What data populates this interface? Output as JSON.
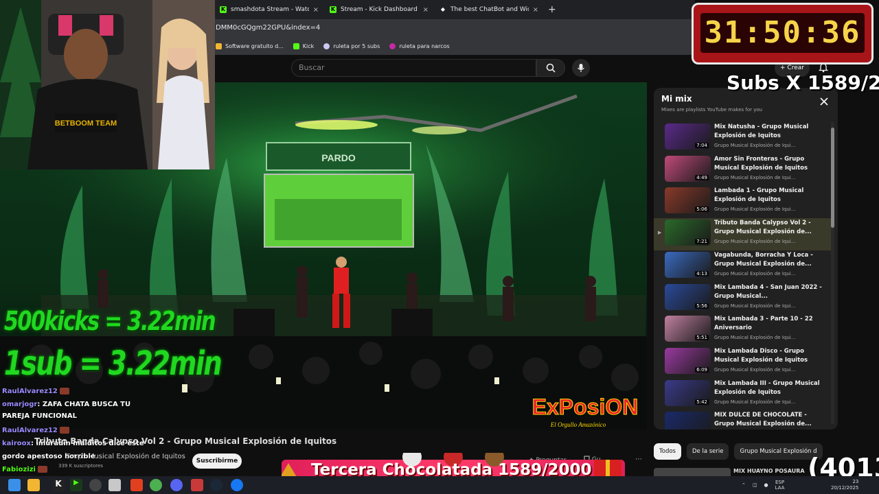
{
  "browser": {
    "tabs": [
      {
        "label": "smashdota Stream - Watch Live",
        "icon": "kick-icon"
      },
      {
        "label": "Stream - Kick Dashboard",
        "icon": "kick-icon"
      },
      {
        "label": "The best ChatBot and Widgets",
        "icon": "botrix-icon"
      }
    ],
    "address": "DMM0cGQgm22GPU&index=4",
    "bookmarks": [
      {
        "label": "Software gratuito d...",
        "icon": "folder-icon"
      },
      {
        "label": "Kick",
        "icon": "kick-icon"
      },
      {
        "label": "ruleta por 5 subs",
        "icon": "wheel-icon"
      },
      {
        "label": "ruleta para narcos",
        "icon": "wheel-icon"
      }
    ]
  },
  "youtube": {
    "search_placeholder": "Buscar",
    "create_label": "Crear",
    "video_title": "Tributo Banda Calypso Vol 2 - Grupo Musical Explosión de Iquitos",
    "channel": "Grupo Musical Explosión de Iquitos",
    "subscribers": "339 K suscriptores",
    "subscribe_label": "Suscribirme",
    "ask_label": "Preguntar",
    "save_label": "Gu",
    "video_logo": "ExPosiON",
    "video_logo_sub": "El Orgullo Amazónico",
    "stage_sign": "PARDO"
  },
  "mix": {
    "title": "Mi mix",
    "subtitle": "Mixes are playlists YouTube makes for you",
    "items": [
      {
        "title": "Mix Natusha - Grupo Musical Explosión de Iquitos",
        "channel": "Grupo Musical Explosión de Iqui...",
        "duration": "7:04"
      },
      {
        "title": "Amor Sin Fronteras - Grupo Musical Explosión de Iquitos",
        "channel": "Grupo Musical Explosión de Iqui...",
        "duration": "4:49"
      },
      {
        "title": "Lambada 1 - Grupo Musical Explosión de Iquitos",
        "channel": "Grupo Musical Explosión de Iqui...",
        "duration": "5:06"
      },
      {
        "title": "Tributo Banda Calypso Vol 2 - Grupo Musical Explosión de...",
        "channel": "Grupo Musical Explosión de Iqui...",
        "duration": "7:21"
      },
      {
        "title": "Vagabunda, Borracha Y Loca - Grupo Musical Explosión de...",
        "channel": "Grupo Musical Explosión de Iqui...",
        "duration": "4:13"
      },
      {
        "title": "Mix Lambada 4 - San Juan 2022 - Grupo Musical...",
        "channel": "Grupo Musical Explosión de Iqui...",
        "duration": "5:56"
      },
      {
        "title": "Mix Lambada 3 - Parte 10 - 22 Aniversario",
        "channel": "Grupo Musical Explosión de Iqui...",
        "duration": "5:51"
      },
      {
        "title": "Mix Lambada Disco - Grupo Musical Explosión de Iquitos",
        "channel": "Grupo Musical Explosión de Iqui...",
        "duration": "6:09"
      },
      {
        "title": "Mix Lambada III - Grupo Musical Explosión de Iquitos",
        "channel": "Grupo Musical Explosión de Iqui...",
        "duration": "5:42"
      },
      {
        "title": "MIX DULCE DE CHOCOLATE - Grupo Musical Explosión de...",
        "channel": "",
        "duration": ""
      }
    ],
    "active_index": 3
  },
  "chips": [
    "Todos",
    "De la serie",
    "Grupo Musical Explosión d"
  ],
  "next_video_title": "MIX HUAYNO POSAURA",
  "overlay": {
    "timer": "31:50:36",
    "subs_label": "Subs X 1589/2",
    "kicks_rate": "500kicks = 3.22min",
    "sub_rate": "1sub = 3.22min",
    "banner": "Tercera Chocolatada 1589/2000",
    "counter": "(4013"
  },
  "chat": [
    {
      "user": "RaulAlvarez12",
      "message": ""
    },
    {
      "user": "omarjogr",
      "message": "ZAFA CHATA BUSCA TU"
    },
    {
      "user": "",
      "message": "PAREJA FUNCIONAL"
    },
    {
      "user": "RaulAlvarez12",
      "message": ""
    },
    {
      "user": "kairoox",
      "message": "imuradin malditos dice este"
    },
    {
      "user": "",
      "message": "gordo apestoso horrible"
    },
    {
      "user": "Fabiozizi",
      "message": ""
    }
  ],
  "webcam": {
    "shirt_text": "BETBOOM TEAM"
  },
  "system": {
    "lang": "ESP",
    "lang2": "LAA",
    "date": "20/12/2025",
    "time": "23"
  },
  "colors": {
    "kick_green": "#53fc18",
    "timer_red": "#a81519",
    "overlay_green": "#20d820"
  }
}
